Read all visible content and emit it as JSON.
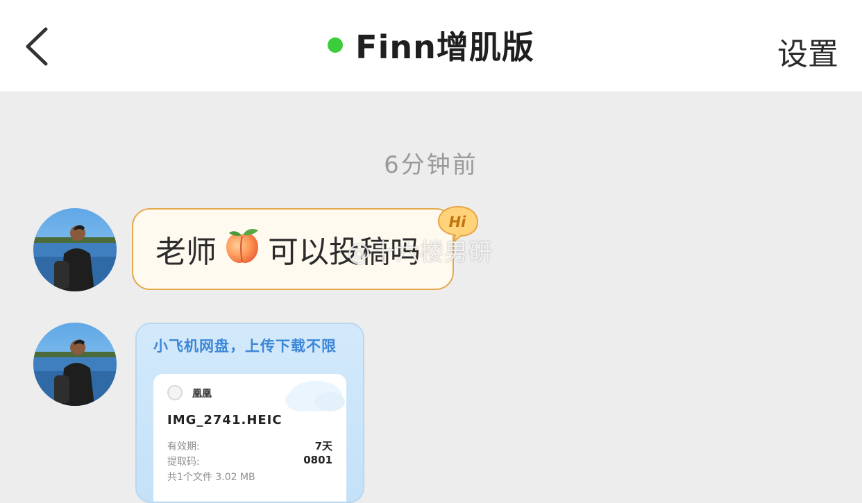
{
  "header": {
    "title": "Finn增肌版",
    "settings_label": "设置",
    "online_color": "#3ccd3c",
    "back_icon": "chevron-left-icon"
  },
  "chat": {
    "timestamp": "6分钟前",
    "message": {
      "text_before": "老师",
      "emoji": "peach",
      "text_after": "可以投稿吗",
      "badge": "Hi"
    },
    "watermark": "@十六楼男研",
    "file_card": {
      "headline": "小飞机网盘，上传下载不限",
      "sharer": "凰凰",
      "filename": "IMG_2741.HEIC",
      "validity_label": "有效期:",
      "validity_value": "7天",
      "code_label": "提取码:",
      "code_value": "0801",
      "summary": "共1个文件  3.02 MB"
    }
  }
}
